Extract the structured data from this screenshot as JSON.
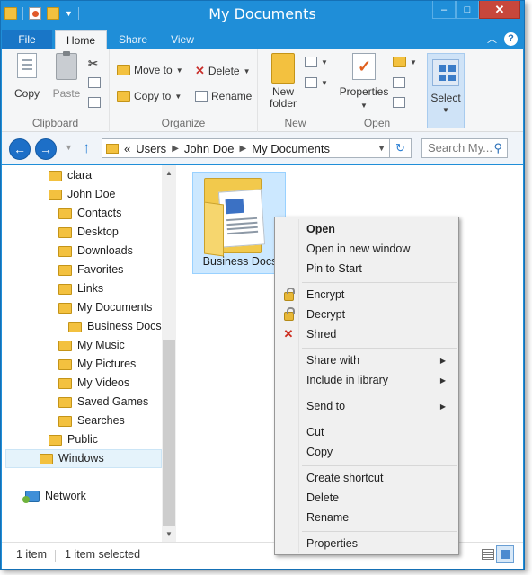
{
  "window": {
    "title": "My Documents",
    "controls": {
      "minimize": "–",
      "maximize": "□",
      "close": "✕"
    }
  },
  "ribbon": {
    "tabs": [
      {
        "label": "File"
      },
      {
        "label": "Home"
      },
      {
        "label": "Share"
      },
      {
        "label": "View"
      }
    ],
    "help": "?",
    "groups": {
      "clipboard": {
        "label": "Clipboard",
        "copy": "Copy",
        "paste": "Paste"
      },
      "organize": {
        "label": "Organize",
        "move_to": "Move to",
        "copy_to": "Copy to",
        "delete": "Delete",
        "rename": "Rename"
      },
      "new": {
        "label": "New",
        "new_folder_line1": "New",
        "new_folder_line2": "folder"
      },
      "open": {
        "label": "Open",
        "properties": "Properties"
      },
      "select": {
        "label": "Select"
      }
    }
  },
  "navigation": {
    "back": "←",
    "forward": "→",
    "breadcrumb": [
      "«",
      "Users",
      "John Doe",
      "My Documents"
    ],
    "search_placeholder": "Search My..."
  },
  "tree": {
    "items": [
      {
        "label": "clara"
      },
      {
        "label": "John Doe"
      },
      {
        "label": "Contacts"
      },
      {
        "label": "Desktop"
      },
      {
        "label": "Downloads"
      },
      {
        "label": "Favorites"
      },
      {
        "label": "Links"
      },
      {
        "label": "My Documents"
      },
      {
        "label": "Business Docs"
      },
      {
        "label": "My Music"
      },
      {
        "label": "My Pictures"
      },
      {
        "label": "My Videos"
      },
      {
        "label": "Saved Games"
      },
      {
        "label": "Searches"
      },
      {
        "label": "Public"
      },
      {
        "label": "Windows"
      },
      {
        "label": "Network"
      }
    ]
  },
  "files": [
    {
      "name": "Business Docs"
    }
  ],
  "context_menu": {
    "items": [
      {
        "label": "Open"
      },
      {
        "label": "Open in new window"
      },
      {
        "label": "Pin to Start"
      },
      {
        "label": "Encrypt"
      },
      {
        "label": "Decrypt"
      },
      {
        "label": "Shred"
      },
      {
        "label": "Share with"
      },
      {
        "label": "Include in library"
      },
      {
        "label": "Send to"
      },
      {
        "label": "Cut"
      },
      {
        "label": "Copy"
      },
      {
        "label": "Create shortcut"
      },
      {
        "label": "Delete"
      },
      {
        "label": "Rename"
      },
      {
        "label": "Properties"
      }
    ]
  },
  "status": {
    "item_count": "1 item",
    "selection": "1 item selected"
  }
}
